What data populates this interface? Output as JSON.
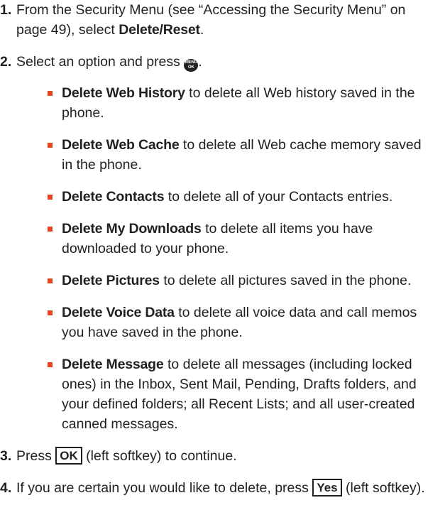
{
  "steps": [
    {
      "number": "1.",
      "text_before": "From the Security Menu (see “Accessing the Security Menu” on page 49), select ",
      "bold": "Delete/Reset",
      "text_after": "."
    },
    {
      "number": "2.",
      "text_before": "Select an option and press ",
      "key_icon": "menu-ok-key",
      "key_label_top": "MENU",
      "key_label_bottom": "OK",
      "text_after": ".",
      "options": [
        {
          "bold": "Delete Web History",
          "text": " to delete all Web history saved in the phone."
        },
        {
          "bold": "Delete Web Cache",
          "text": " to delete all Web cache memory saved in the phone."
        },
        {
          "bold": "Delete Contacts",
          "text": " to delete all of your Contacts entries."
        },
        {
          "bold": "Delete My Downloads",
          "text": " to delete all items you have downloaded to your phone."
        },
        {
          "bold": "Delete Pictures",
          "text": " to delete all pictures saved in the phone."
        },
        {
          "bold": "Delete Voice Data",
          "text": " to delete all voice data and call memos you have saved in the phone."
        },
        {
          "bold": "Delete Message",
          "text": " to delete all messages (including locked ones) in the Inbox, Sent Mail, Pending, Drafts folders, and your defined folders; all Recent Lists; and all user-created canned messages."
        }
      ]
    },
    {
      "number": "3.",
      "text_before": "Press ",
      "softkey": "OK",
      "text_after": " (left softkey) to continue."
    },
    {
      "number": "4.",
      "text_before": "If you are certain you would like to delete, press ",
      "softkey": "Yes",
      "text_after": " (left softkey)."
    }
  ],
  "colors": {
    "text": "#231f20",
    "bullet": "#e8441f"
  }
}
